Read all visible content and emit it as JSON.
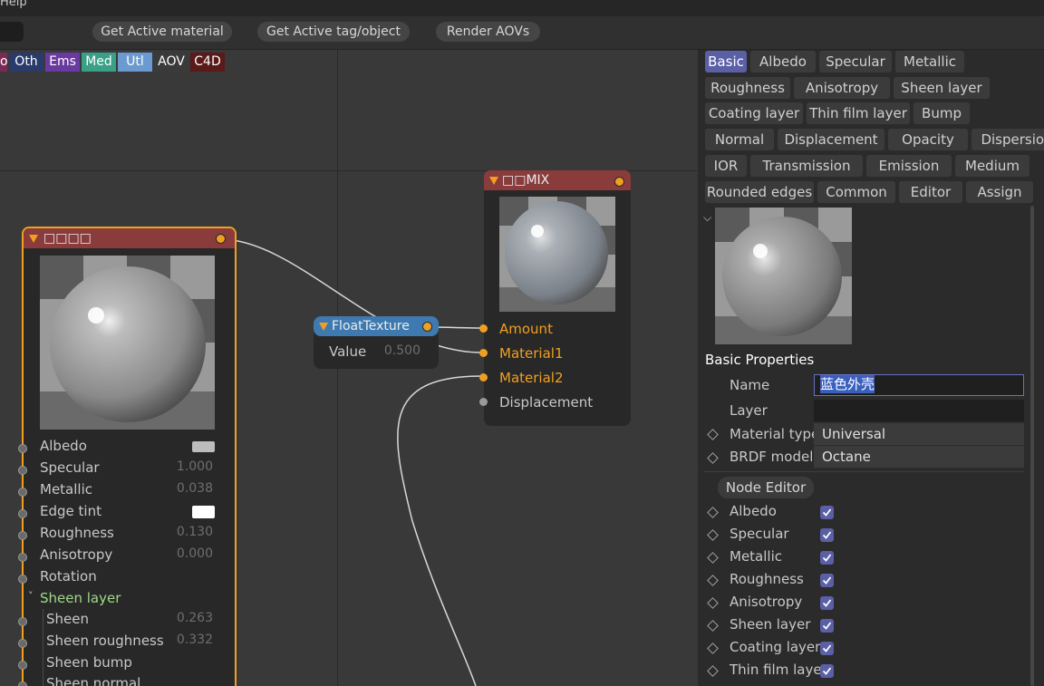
{
  "menubar": {
    "help": "Help"
  },
  "toolbar": {
    "buttons": [
      "Get Active material",
      "Get Active tag/object",
      "Render AOVs"
    ]
  },
  "categories": [
    {
      "label": "o",
      "color": "#7a2a55"
    },
    {
      "label": "Oth",
      "color": "#2a3a6a"
    },
    {
      "label": "Ems",
      "color": "#6a3aa0"
    },
    {
      "label": "Med",
      "color": "#3aa088"
    },
    {
      "label": "Utl",
      "color": "#6a9ad0"
    },
    {
      "label": "AOV",
      "color": "#3a3a3a"
    },
    {
      "label": "C4D",
      "color": "#5a1a1a"
    }
  ],
  "nodes": {
    "material": {
      "title": "□□□□",
      "params": [
        {
          "label": "Albedo",
          "value": ""
        },
        {
          "label": "Specular",
          "value": "1.000"
        },
        {
          "label": "Metallic",
          "value": "0.038"
        },
        {
          "label": "Edge tint",
          "value": ""
        },
        {
          "label": "Roughness",
          "value": "0.130"
        },
        {
          "label": "Anisotropy",
          "value": "0.000"
        },
        {
          "label": "Rotation",
          "value": ""
        },
        {
          "label": "Sheen layer",
          "value": ""
        },
        {
          "label": "Sheen",
          "value": "0.263"
        },
        {
          "label": "Sheen roughness",
          "value": "0.332"
        },
        {
          "label": "Sheen bump",
          "value": ""
        },
        {
          "label": "Sheen normal",
          "value": ""
        }
      ]
    },
    "float": {
      "title": "FloatTexture",
      "label": "Value",
      "value": "0.500"
    },
    "mix": {
      "title": "□□MIX",
      "inputs": [
        "Amount",
        "Material1",
        "Material2",
        "Displacement"
      ]
    }
  },
  "panel": {
    "tabs": [
      [
        "Basic",
        "Albedo",
        "Specular",
        "Metallic"
      ],
      [
        "Roughness",
        "Anisotropy",
        "Sheen layer"
      ],
      [
        "Coating layer",
        "Thin film layer",
        "Bump"
      ],
      [
        "Normal",
        "Displacement",
        "Opacity",
        "Dispersion"
      ],
      [
        "IOR",
        "Transmission",
        "Emission",
        "Medium"
      ],
      [
        "Rounded edges",
        "Common",
        "Editor",
        "Assign"
      ]
    ],
    "section_title": "Basic Properties",
    "name_label": "Name",
    "name_value": "蓝色外壳",
    "layer_label": "Layer",
    "material_type_label": "Material type",
    "material_type_value": "Universal",
    "brdf_label": "BRDF model",
    "brdf_value": "Octane",
    "node_editor": "Node Editor",
    "checks": [
      "Albedo",
      "Specular",
      "Metallic",
      "Roughness",
      "Anisotropy",
      "Sheen layer",
      "Coating layer",
      "Thin film layer"
    ]
  },
  "colors": {
    "accent": "#5a5fa6",
    "node_head_red": "#8a3b3b",
    "node_head_blue": "#3e7ab0",
    "port_orange": "#f0a020"
  }
}
